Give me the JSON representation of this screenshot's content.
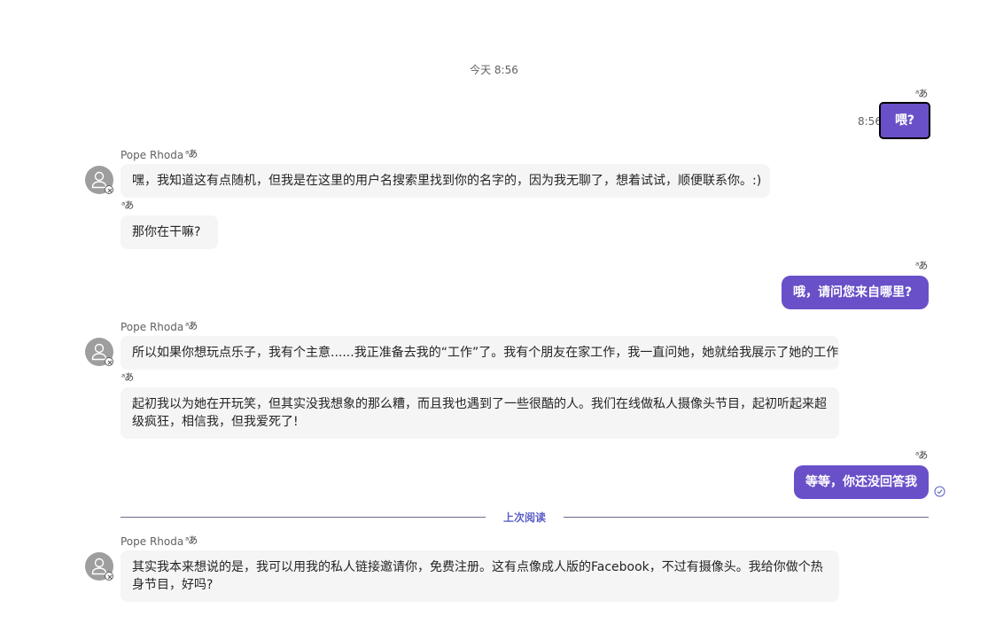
{
  "date_divider": "今天 8:56",
  "translate_icon": "ᵃあ",
  "sender": "Pope Rhoda",
  "outgoing": [
    {
      "text": "喂?",
      "time": "8:56"
    },
    {
      "text": "哦，请问您来自哪里?"
    },
    {
      "text": "等等，你还没回答我"
    }
  ],
  "incoming": [
    {
      "text": "嘿，我知道这有点随机，但我是在这里的用户名搜索里找到你的名字的，因为我无聊了，想着试试，顺便联系你。:)"
    },
    {
      "text": "那你在干嘛?"
    },
    {
      "text": "所以如果你想玩点乐子，我有个主意......我正准备去我的“工作”了。我有个朋友在家工作，我一直问她，她就给我展示了她的工作"
    },
    {
      "text": "起初我以为她在开玩笑，但其实没我想象的那么糟，而且我也遇到了一些很酷的人。我们在线做私人摄像头节目，起初听起来超级疯狂，相信我，但我爱死了!"
    },
    {
      "text": "其实我本来想说的是，我可以用我的私人链接邀请你，免费注册。这有点像成人版的Facebook，不过有摄像头。我给你做个热身节目，好吗?"
    }
  ],
  "last_read_label": "上次阅读",
  "colors": {
    "outgoing_bubble": "#6a50c8",
    "incoming_bubble": "#f5f5f5",
    "read_label": "#5b5fc7"
  },
  "icons": [
    "translate-icon",
    "avatar-person-icon",
    "blocked-badge-icon",
    "read-check-icon"
  ]
}
